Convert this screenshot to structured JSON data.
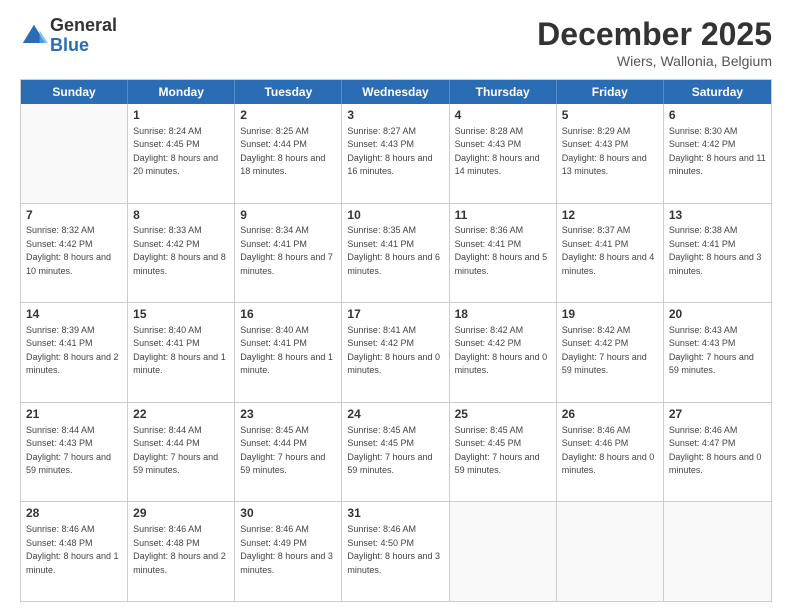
{
  "logo": {
    "general": "General",
    "blue": "Blue"
  },
  "header": {
    "month": "December 2025",
    "location": "Wiers, Wallonia, Belgium"
  },
  "days": [
    "Sunday",
    "Monday",
    "Tuesday",
    "Wednesday",
    "Thursday",
    "Friday",
    "Saturday"
  ],
  "rows": [
    [
      {
        "day": "",
        "empty": true
      },
      {
        "day": "1",
        "sunrise": "Sunrise: 8:24 AM",
        "sunset": "Sunset: 4:45 PM",
        "daylight": "Daylight: 8 hours and 20 minutes."
      },
      {
        "day": "2",
        "sunrise": "Sunrise: 8:25 AM",
        "sunset": "Sunset: 4:44 PM",
        "daylight": "Daylight: 8 hours and 18 minutes."
      },
      {
        "day": "3",
        "sunrise": "Sunrise: 8:27 AM",
        "sunset": "Sunset: 4:43 PM",
        "daylight": "Daylight: 8 hours and 16 minutes."
      },
      {
        "day": "4",
        "sunrise": "Sunrise: 8:28 AM",
        "sunset": "Sunset: 4:43 PM",
        "daylight": "Daylight: 8 hours and 14 minutes."
      },
      {
        "day": "5",
        "sunrise": "Sunrise: 8:29 AM",
        "sunset": "Sunset: 4:43 PM",
        "daylight": "Daylight: 8 hours and 13 minutes."
      },
      {
        "day": "6",
        "sunrise": "Sunrise: 8:30 AM",
        "sunset": "Sunset: 4:42 PM",
        "daylight": "Daylight: 8 hours and 11 minutes."
      }
    ],
    [
      {
        "day": "7",
        "sunrise": "Sunrise: 8:32 AM",
        "sunset": "Sunset: 4:42 PM",
        "daylight": "Daylight: 8 hours and 10 minutes."
      },
      {
        "day": "8",
        "sunrise": "Sunrise: 8:33 AM",
        "sunset": "Sunset: 4:42 PM",
        "daylight": "Daylight: 8 hours and 8 minutes."
      },
      {
        "day": "9",
        "sunrise": "Sunrise: 8:34 AM",
        "sunset": "Sunset: 4:41 PM",
        "daylight": "Daylight: 8 hours and 7 minutes."
      },
      {
        "day": "10",
        "sunrise": "Sunrise: 8:35 AM",
        "sunset": "Sunset: 4:41 PM",
        "daylight": "Daylight: 8 hours and 6 minutes."
      },
      {
        "day": "11",
        "sunrise": "Sunrise: 8:36 AM",
        "sunset": "Sunset: 4:41 PM",
        "daylight": "Daylight: 8 hours and 5 minutes."
      },
      {
        "day": "12",
        "sunrise": "Sunrise: 8:37 AM",
        "sunset": "Sunset: 4:41 PM",
        "daylight": "Daylight: 8 hours and 4 minutes."
      },
      {
        "day": "13",
        "sunrise": "Sunrise: 8:38 AM",
        "sunset": "Sunset: 4:41 PM",
        "daylight": "Daylight: 8 hours and 3 minutes."
      }
    ],
    [
      {
        "day": "14",
        "sunrise": "Sunrise: 8:39 AM",
        "sunset": "Sunset: 4:41 PM",
        "daylight": "Daylight: 8 hours and 2 minutes."
      },
      {
        "day": "15",
        "sunrise": "Sunrise: 8:40 AM",
        "sunset": "Sunset: 4:41 PM",
        "daylight": "Daylight: 8 hours and 1 minute."
      },
      {
        "day": "16",
        "sunrise": "Sunrise: 8:40 AM",
        "sunset": "Sunset: 4:41 PM",
        "daylight": "Daylight: 8 hours and 1 minute."
      },
      {
        "day": "17",
        "sunrise": "Sunrise: 8:41 AM",
        "sunset": "Sunset: 4:42 PM",
        "daylight": "Daylight: 8 hours and 0 minutes."
      },
      {
        "day": "18",
        "sunrise": "Sunrise: 8:42 AM",
        "sunset": "Sunset: 4:42 PM",
        "daylight": "Daylight: 8 hours and 0 minutes."
      },
      {
        "day": "19",
        "sunrise": "Sunrise: 8:42 AM",
        "sunset": "Sunset: 4:42 PM",
        "daylight": "Daylight: 7 hours and 59 minutes."
      },
      {
        "day": "20",
        "sunrise": "Sunrise: 8:43 AM",
        "sunset": "Sunset: 4:43 PM",
        "daylight": "Daylight: 7 hours and 59 minutes."
      }
    ],
    [
      {
        "day": "21",
        "sunrise": "Sunrise: 8:44 AM",
        "sunset": "Sunset: 4:43 PM",
        "daylight": "Daylight: 7 hours and 59 minutes."
      },
      {
        "day": "22",
        "sunrise": "Sunrise: 8:44 AM",
        "sunset": "Sunset: 4:44 PM",
        "daylight": "Daylight: 7 hours and 59 minutes."
      },
      {
        "day": "23",
        "sunrise": "Sunrise: 8:45 AM",
        "sunset": "Sunset: 4:44 PM",
        "daylight": "Daylight: 7 hours and 59 minutes."
      },
      {
        "day": "24",
        "sunrise": "Sunrise: 8:45 AM",
        "sunset": "Sunset: 4:45 PM",
        "daylight": "Daylight: 7 hours and 59 minutes."
      },
      {
        "day": "25",
        "sunrise": "Sunrise: 8:45 AM",
        "sunset": "Sunset: 4:45 PM",
        "daylight": "Daylight: 7 hours and 59 minutes."
      },
      {
        "day": "26",
        "sunrise": "Sunrise: 8:46 AM",
        "sunset": "Sunset: 4:46 PM",
        "daylight": "Daylight: 8 hours and 0 minutes."
      },
      {
        "day": "27",
        "sunrise": "Sunrise: 8:46 AM",
        "sunset": "Sunset: 4:47 PM",
        "daylight": "Daylight: 8 hours and 0 minutes."
      }
    ],
    [
      {
        "day": "28",
        "sunrise": "Sunrise: 8:46 AM",
        "sunset": "Sunset: 4:48 PM",
        "daylight": "Daylight: 8 hours and 1 minute."
      },
      {
        "day": "29",
        "sunrise": "Sunrise: 8:46 AM",
        "sunset": "Sunset: 4:48 PM",
        "daylight": "Daylight: 8 hours and 2 minutes."
      },
      {
        "day": "30",
        "sunrise": "Sunrise: 8:46 AM",
        "sunset": "Sunset: 4:49 PM",
        "daylight": "Daylight: 8 hours and 3 minutes."
      },
      {
        "day": "31",
        "sunrise": "Sunrise: 8:46 AM",
        "sunset": "Sunset: 4:50 PM",
        "daylight": "Daylight: 8 hours and 3 minutes."
      },
      {
        "day": "",
        "empty": true
      },
      {
        "day": "",
        "empty": true
      },
      {
        "day": "",
        "empty": true
      }
    ]
  ]
}
